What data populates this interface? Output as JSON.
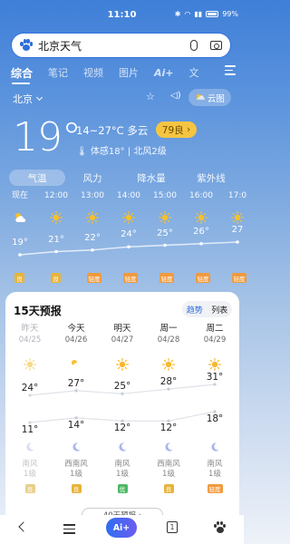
{
  "status": {
    "time": "11:10",
    "battery": "99%"
  },
  "search": {
    "query": "北京天气"
  },
  "tabs": [
    "综合",
    "笔记",
    "视频",
    "图片",
    "Ai+",
    "文"
  ],
  "location": {
    "city": "北京",
    "cloudmap_label": "云图"
  },
  "current": {
    "temp": "19°",
    "range": "14~27°C 多云",
    "aqi": "79良",
    "feels": "体感18° | 北风2级"
  },
  "metric_tabs": [
    "气温",
    "风力",
    "降水量",
    "紫外线"
  ],
  "hourly": [
    {
      "time": "现在",
      "icon": "partly-cloudy-icon",
      "temp": "19°",
      "aqi": "良",
      "aqi_color": "#e8b33a"
    },
    {
      "time": "12:00",
      "icon": "sun-icon",
      "temp": "21°",
      "aqi": "良",
      "aqi_color": "#e8b33a"
    },
    {
      "time": "13:00",
      "icon": "sun-icon",
      "temp": "22°",
      "aqi": "轻度",
      "aqi_color": "#f09a3e"
    },
    {
      "time": "14:00",
      "icon": "sun-icon",
      "temp": "24°",
      "aqi": "轻度",
      "aqi_color": "#f09a3e"
    },
    {
      "time": "15:00",
      "icon": "sun-icon",
      "temp": "25°",
      "aqi": "轻度",
      "aqi_color": "#f09a3e"
    },
    {
      "time": "16:00",
      "icon": "sun-icon",
      "temp": "26°",
      "aqi": "轻度",
      "aqi_color": "#f09a3e"
    },
    {
      "time": "17:0",
      "icon": "sun-icon",
      "temp": "27",
      "aqi": "轻度",
      "aqi_color": "#f09a3e"
    }
  ],
  "forecast": {
    "title": "15天预报",
    "toggle": [
      "趋势",
      "列表"
    ],
    "more_label": "40天预报 ›",
    "days": [
      {
        "day": "昨天",
        "date": "04/25",
        "high": "24°",
        "low": "11°",
        "wind": "南风",
        "level": "1级",
        "aqi": "良",
        "aqi_color": "#e8cf8a",
        "past": true
      },
      {
        "day": "今天",
        "date": "04/26",
        "high": "27°",
        "low": "14°",
        "wind": "西南风",
        "level": "1级",
        "aqi": "良",
        "aqi_color": "#e8b33a",
        "past": false
      },
      {
        "day": "明天",
        "date": "04/27",
        "high": "25°",
        "low": "12°",
        "wind": "南风",
        "level": "1级",
        "aqi": "优",
        "aqi_color": "#4cb865",
        "past": false
      },
      {
        "day": "周一",
        "date": "04/28",
        "high": "28°",
        "low": "12°",
        "wind": "西南风",
        "level": "1级",
        "aqi": "良",
        "aqi_color": "#e8b33a",
        "past": false
      },
      {
        "day": "周二",
        "date": "04/29",
        "high": "31°",
        "low": "18°",
        "wind": "南风",
        "level": "1级",
        "aqi": "轻度",
        "aqi_color": "#f09a3e",
        "past": false
      }
    ]
  },
  "bottom_nav": {
    "ai_label": "Ai+",
    "pages_count": "1"
  }
}
